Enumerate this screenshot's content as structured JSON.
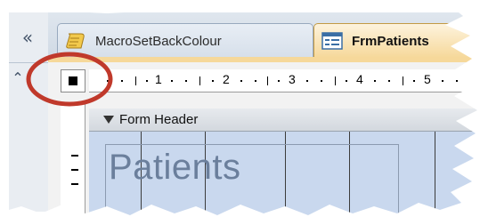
{
  "nav": {
    "collapse_icon": "double-chevron-left-icon",
    "collapse_glyph": "«",
    "expand_icon": "double-chevron-up-icon",
    "expand_glyph": "⌃"
  },
  "tabs": [
    {
      "label": "MacroSetBackColour",
      "icon": "macro-scroll-icon",
      "active": false
    },
    {
      "label": "FrmPatients",
      "icon": "form-icon",
      "active": true
    }
  ],
  "ruler": {
    "numbers": [
      "1",
      "2",
      "3",
      "4",
      "5"
    ]
  },
  "design": {
    "section_label": "Form Header",
    "form_title": "Patients"
  },
  "colors": {
    "annotation": "#c0392b",
    "active_tab": "#f6d89a",
    "form_area": "#c9d8ee"
  }
}
